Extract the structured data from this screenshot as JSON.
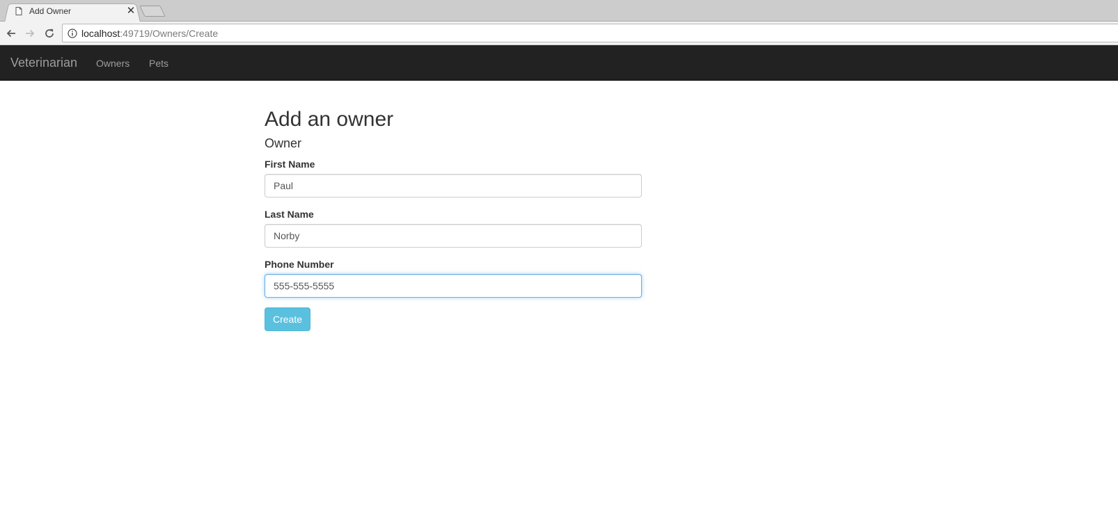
{
  "browser": {
    "tab": {
      "title": "Add Owner",
      "close_glyph": "✕"
    },
    "address": {
      "host": "localhost",
      "path": ":49719/Owners/Create"
    }
  },
  "navbar": {
    "brand": "Veterinarian",
    "links": [
      {
        "label": "Owners"
      },
      {
        "label": "Pets"
      }
    ]
  },
  "page": {
    "title": "Add an owner",
    "subtitle": "Owner",
    "fields": [
      {
        "label": "First Name",
        "value": "Paul"
      },
      {
        "label": "Last Name",
        "value": "Norby"
      },
      {
        "label": "Phone Number",
        "value": "555-555-5555"
      }
    ],
    "submit_label": "Create"
  },
  "colors": {
    "navbar_bg": "#222222",
    "nav_text": "#9d9d9d",
    "button_info": "#5bc0de",
    "focus_border": "#66afe9"
  },
  "icons": [
    "page-favicon-icon",
    "close-icon",
    "new-tab-icon",
    "back-arrow-icon",
    "forward-arrow-icon",
    "reload-icon",
    "info-icon"
  ]
}
